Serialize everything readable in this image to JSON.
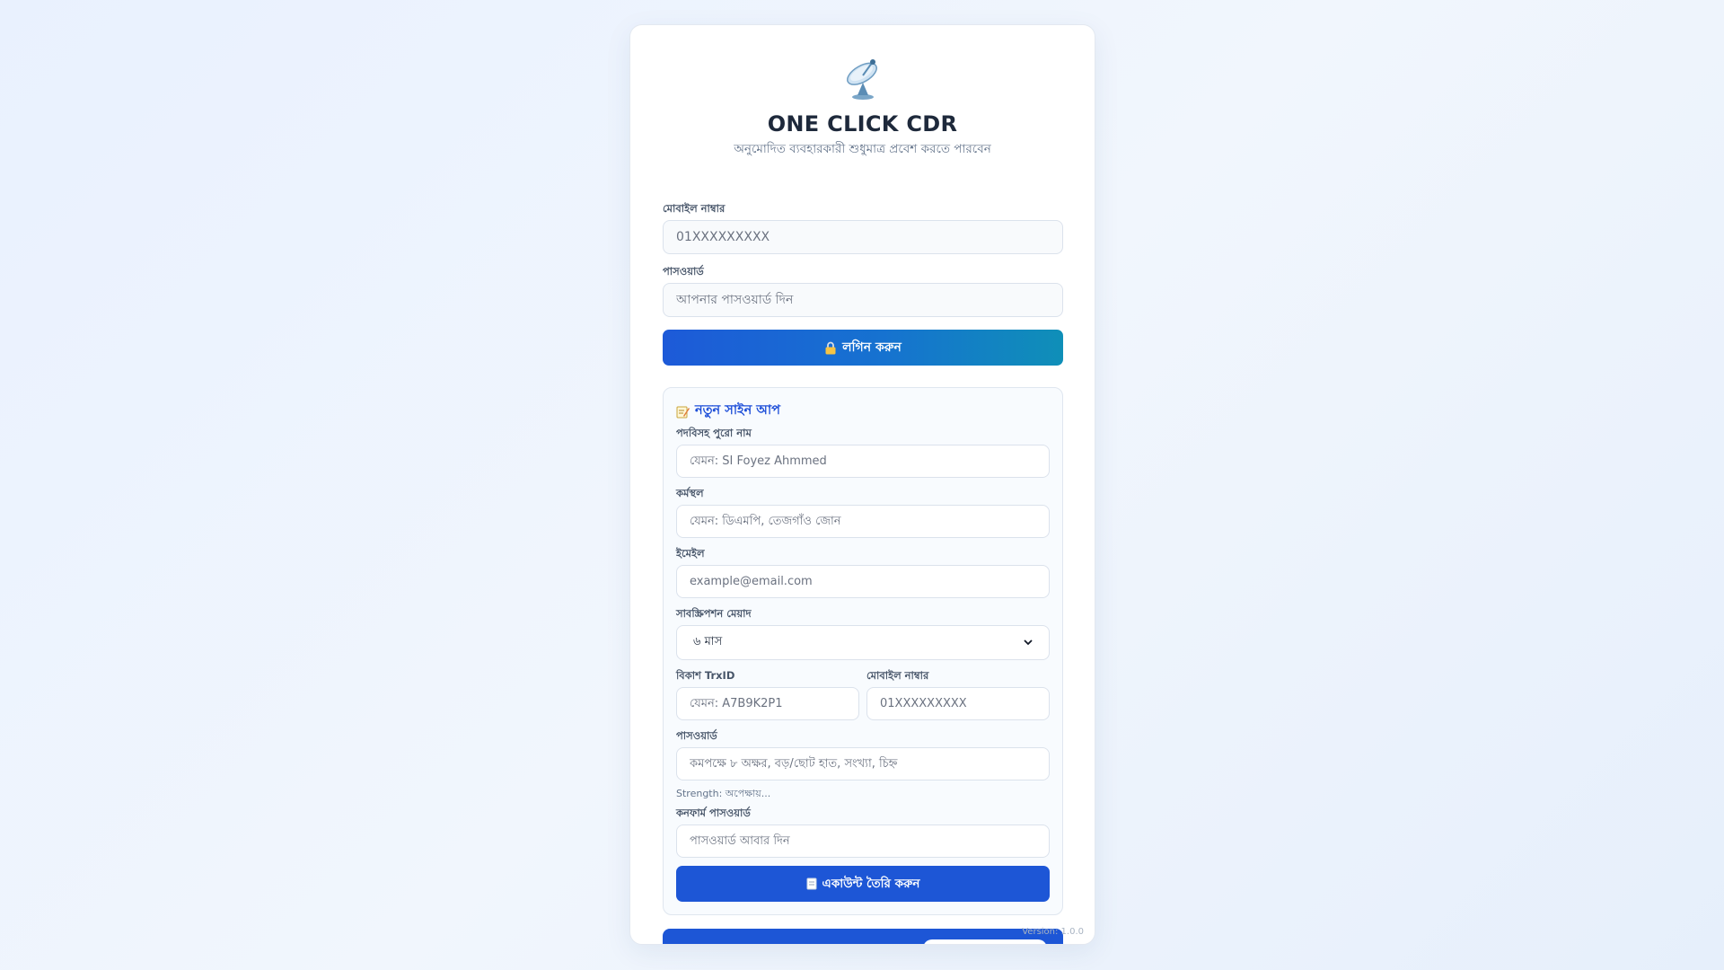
{
  "app": {
    "title": "ONE CLICK CDR",
    "subtitle": "অনুমোদিত ব্যবহারকারী শুধুমাত্র প্রবেশ করতে পারবেন",
    "logo_icon": "satellite-dish-icon",
    "version": "Version: 1.0.0"
  },
  "login": {
    "mobile_label": "মোবাইল নাম্বার",
    "mobile_placeholder": "01XXXXXXXXX",
    "password_label": "পাসওয়ার্ড",
    "password_placeholder": "আপনার পাসওয়ার্ড দিন",
    "button_icon": "lock-icon",
    "button_label": "লগিন করুন"
  },
  "signup": {
    "title_icon": "memo-icon",
    "title": "নতুন সাইন আপ",
    "fullname_label": "পদবিসহ পুরো নাম",
    "fullname_placeholder": "যেমন: SI Foyez Ahmmed",
    "workplace_label": "কর্মস্থল",
    "workplace_placeholder": "যেমন: ডিএমপি, তেজগাঁও জোন",
    "email_label": "ইমেইল",
    "email_placeholder": "example@email.com",
    "subscription_label": "সাবস্ক্রিপশন মেয়াদ",
    "subscription_value": "৬ মাস",
    "trxid_label": "বিকাশ TrxID",
    "trxid_placeholder": "যেমন: A7B9K2P1",
    "mobile_label": "মোবাইল নাম্বার",
    "mobile_placeholder": "01XXXXXXXXX",
    "password_label": "পাসওয়ার্ড",
    "password_placeholder": "কমপক্ষে ৮ অক্ষর, বড়/ছোট হাত, সংখ্যা, চিহ্ন",
    "strength_text": "Strength: অপেক্ষায়...",
    "confirm_label": "কনফার্ম পাসওয়ার্ড",
    "confirm_placeholder": "পাসওয়ার্ড আবার দিন",
    "button_icon": "document-icon",
    "button_label": "একাউন্ট তৈরি করুন"
  },
  "colors": {
    "accent": "#1d56d6",
    "accent_teal": "#0f8fb8",
    "title_text": "#1e293b",
    "signup_title": "#1d4ed8"
  }
}
